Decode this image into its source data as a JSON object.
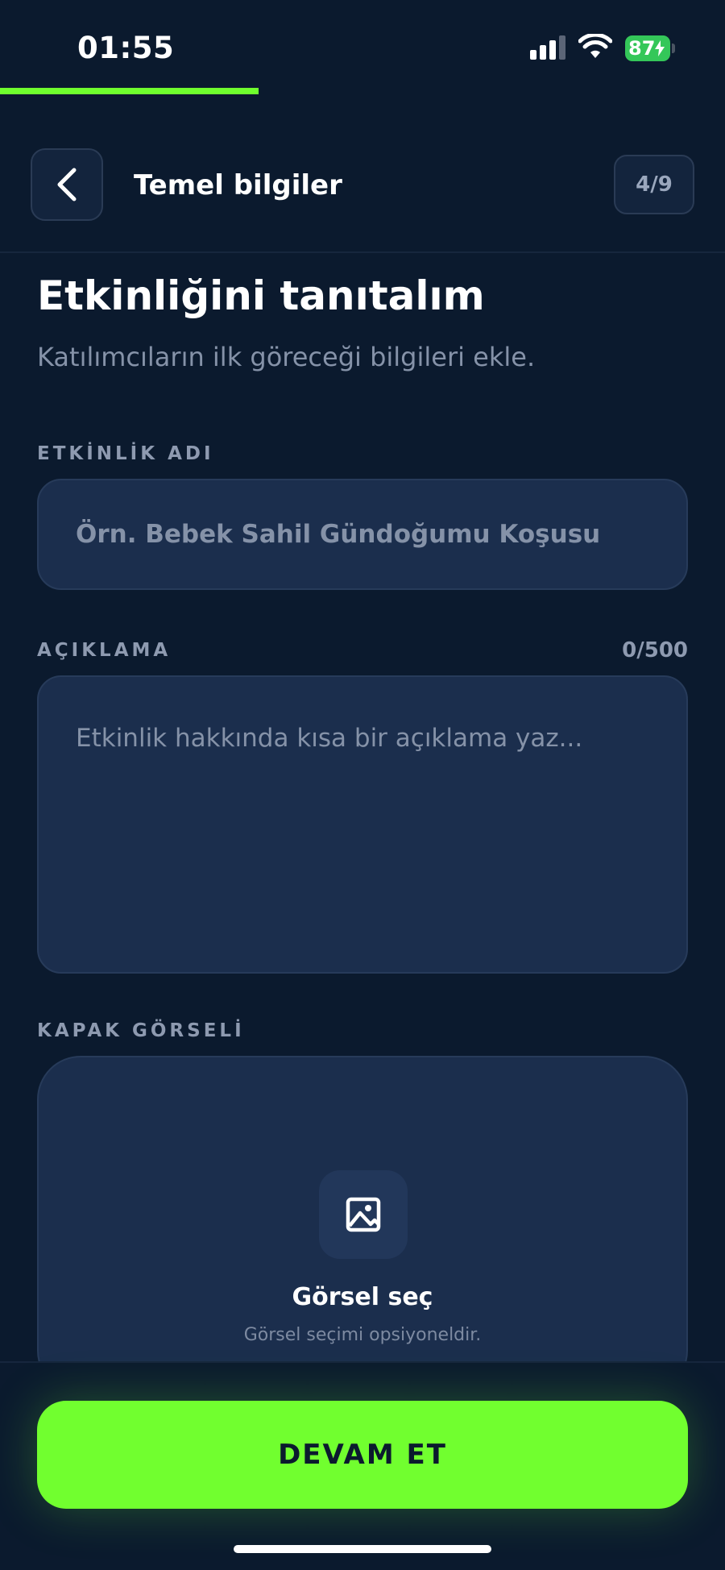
{
  "status_bar": {
    "time": "01:55",
    "battery_level": "87",
    "battery_color": "#34c759"
  },
  "progress": {
    "fraction": 0.357,
    "color": "#6fff2e"
  },
  "header": {
    "back_icon": "chevron-left-icon",
    "title": "Temel bilgiler",
    "step": "4/9"
  },
  "page": {
    "title": "Etkinliğini tanıtalım",
    "subtitle": "Katılımcıların ilk göreceği bilgileri ekle."
  },
  "fields": {
    "name": {
      "label": "ETKİNLİK ADI",
      "placeholder": "Örn. Bebek Sahil Gündoğumu Koşusu",
      "value": ""
    },
    "description": {
      "label": "AÇIKLAMA",
      "counter": "0/500",
      "placeholder": "Etkinlik hakkında kısa bir açıklama yaz...",
      "value": ""
    },
    "cover": {
      "label": "KAPAK GÖRSELİ",
      "icon": "image-icon",
      "title": "Görsel seç",
      "hint": "Görsel seçimi opsiyoneldir."
    }
  },
  "footer": {
    "continue_label": "DEVAM ET",
    "accent_color": "#71ff2f"
  }
}
